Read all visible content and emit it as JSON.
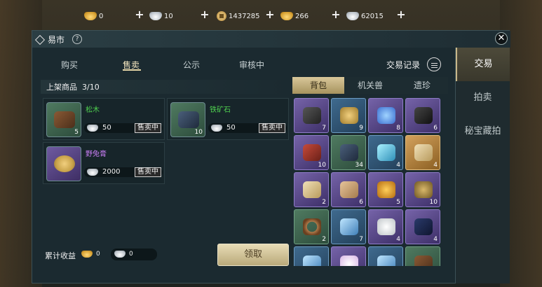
{
  "currencies": [
    {
      "name": "gold-ingot",
      "value": "0"
    },
    {
      "name": "silver-ingot",
      "value": "10"
    },
    {
      "name": "copper-coin",
      "value": "1437285"
    },
    {
      "name": "gold-ingot-bound",
      "value": "266"
    },
    {
      "name": "silver-ingot-bound",
      "value": "62015"
    }
  ],
  "panel": {
    "title": "易市",
    "help": "?"
  },
  "subtabs": [
    "购买",
    "售卖",
    "公示",
    "审核中"
  ],
  "trade_record": "交易记录",
  "side_tabs": [
    "交易",
    "拍卖",
    "秘宝藏拍"
  ],
  "listing": {
    "label": "上架商品",
    "count": "3/10"
  },
  "listed_items": [
    {
      "name": "松木",
      "qty": "5",
      "price": "50",
      "status": "售卖中",
      "rarity": "green"
    },
    {
      "name": "铁矿石",
      "qty": "10",
      "price": "50",
      "status": "售卖中",
      "rarity": "green"
    },
    {
      "name": "野兔膏",
      "qty": "",
      "price": "2000",
      "status": "售卖中",
      "rarity": "purple"
    }
  ],
  "earnings": {
    "label": "累计收益",
    "gold": "0",
    "silver": "0"
  },
  "claim_button": "领取",
  "inventory": {
    "tabs": [
      "背包",
      "机关兽",
      "遗珍"
    ],
    "slots": [
      {
        "count": "7",
        "rarity": "purple",
        "icon": "anvil-icon"
      },
      {
        "count": "9",
        "rarity": "blue",
        "icon": "ointment-icon"
      },
      {
        "count": "8",
        "rarity": "purple",
        "icon": "potion-icon"
      },
      {
        "count": "6",
        "rarity": "purple",
        "icon": "ore-icon"
      },
      {
        "count": "10",
        "rarity": "purple",
        "icon": "box-icon"
      },
      {
        "count": "34",
        "rarity": "green",
        "icon": "iron-ore-icon"
      },
      {
        "count": "4",
        "rarity": "blue",
        "icon": "crystal-icon"
      },
      {
        "count": "4",
        "rarity": "orange",
        "icon": "scroll-icon"
      },
      {
        "count": "2",
        "rarity": "purple",
        "icon": "scroll-icon"
      },
      {
        "count": "6",
        "rarity": "purple",
        "icon": "map-icon"
      },
      {
        "count": "5",
        "rarity": "purple",
        "icon": "amber-icon"
      },
      {
        "count": "10",
        "rarity": "purple",
        "icon": "gear-icon"
      },
      {
        "count": "2",
        "rarity": "green",
        "icon": "rope-icon"
      },
      {
        "count": "7",
        "rarity": "blue",
        "icon": "blueprint-icon"
      },
      {
        "count": "4",
        "rarity": "purple",
        "icon": "eggs-icon"
      },
      {
        "count": "4",
        "rarity": "purple",
        "icon": "hood-icon"
      },
      {
        "count": "",
        "rarity": "blue",
        "icon": "blueprint-icon"
      },
      {
        "count": "",
        "rarity": "purple",
        "icon": "flower-icon"
      },
      {
        "count": "",
        "rarity": "blue",
        "icon": "blueprint-icon"
      },
      {
        "count": "",
        "rarity": "green",
        "icon": "log-icon"
      }
    ]
  }
}
